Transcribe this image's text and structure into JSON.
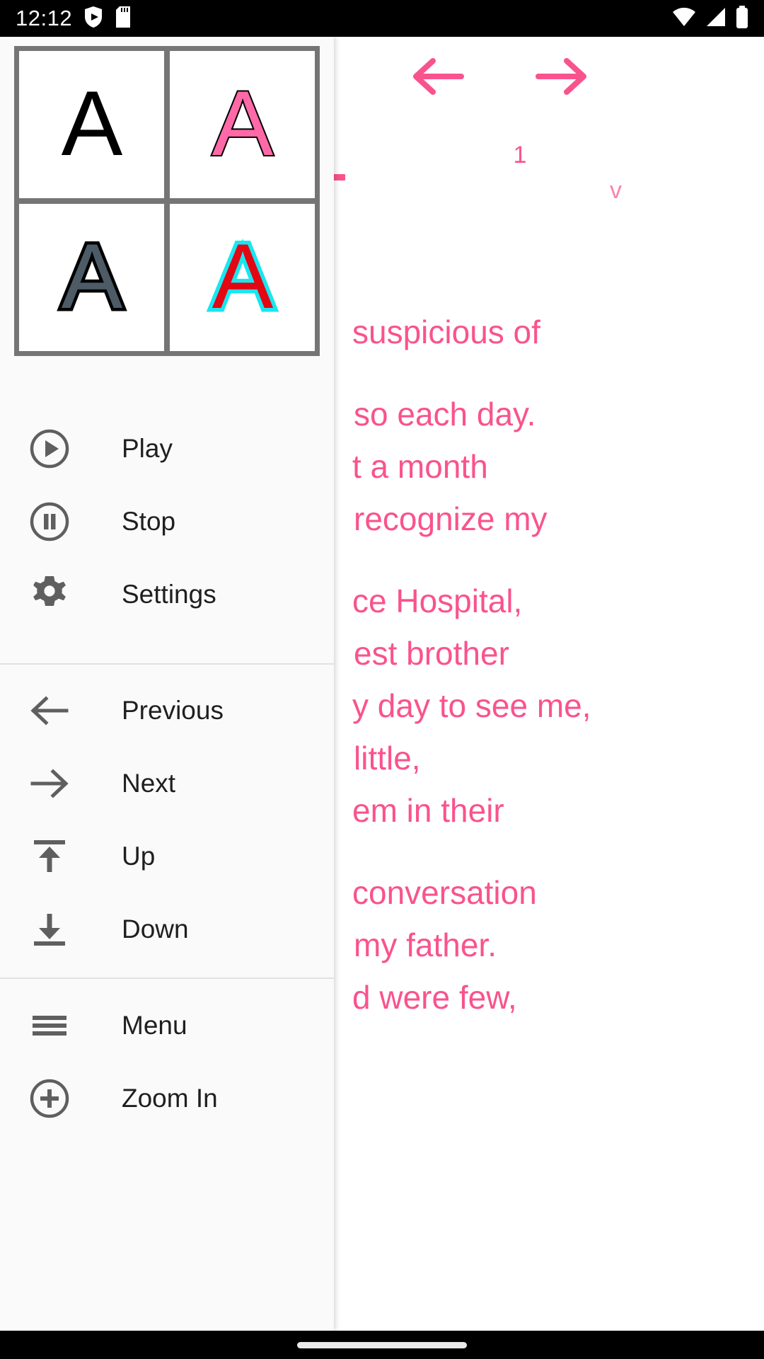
{
  "status_bar": {
    "clock": "12:12",
    "left_icons": [
      "play-protect-shield-icon",
      "sd-card-icon"
    ],
    "right_icons": [
      "wifi-icon",
      "cellular-signal-icon",
      "battery-icon"
    ]
  },
  "reader": {
    "page_number": "1",
    "side_glyph": "v",
    "prev_icon": "arrow-left-icon",
    "next_icon": "arrow-right-icon",
    "accent_color": "#f9538d",
    "lines": [
      "suspicious of",
      "so each day.",
      "t a month",
      "recognize my",
      "ce Hospital,",
      "est brother",
      "y day to see me,",
      "little,",
      "em in their",
      "conversation",
      "my father.",
      "d were few,"
    ]
  },
  "drawer": {
    "style_swatches": [
      {
        "name": "style-default",
        "letter": "A",
        "fill": "#000000",
        "stroke": "#000000",
        "stroke_width": 0
      },
      {
        "name": "style-pink-outline",
        "letter": "A",
        "fill": "#ff69a8",
        "stroke": "#000000",
        "stroke_width": 4
      },
      {
        "name": "style-slate-outline",
        "letter": "A",
        "fill": "#4c5b66",
        "stroke": "#000000",
        "stroke_width": 9
      },
      {
        "name": "style-red-cyan-outline",
        "letter": "A",
        "fill": "#e30613",
        "stroke": "#19e6f0",
        "stroke_width": 11
      }
    ],
    "grid_border_color": "#757575",
    "groups": [
      {
        "name": "playback-group",
        "items": [
          {
            "label": "Play",
            "icon": "play-circle-icon"
          },
          {
            "label": "Stop",
            "icon": "pause-circle-icon"
          },
          {
            "label": "Settings",
            "icon": "gear-icon"
          }
        ]
      },
      {
        "name": "navigation-group",
        "items": [
          {
            "label": "Previous",
            "icon": "arrow-left-icon"
          },
          {
            "label": "Next",
            "icon": "arrow-right-icon"
          },
          {
            "label": "Up",
            "icon": "arrow-up-to-bar-icon"
          },
          {
            "label": "Down",
            "icon": "arrow-down-to-bar-icon"
          }
        ]
      },
      {
        "name": "tools-group",
        "items": [
          {
            "label": "Menu",
            "icon": "hamburger-menu-icon"
          },
          {
            "label": "Zoom In",
            "icon": "plus-circle-icon"
          }
        ]
      }
    ]
  },
  "nav_bar": {
    "gesture_pill": "home-gesture-pill"
  }
}
